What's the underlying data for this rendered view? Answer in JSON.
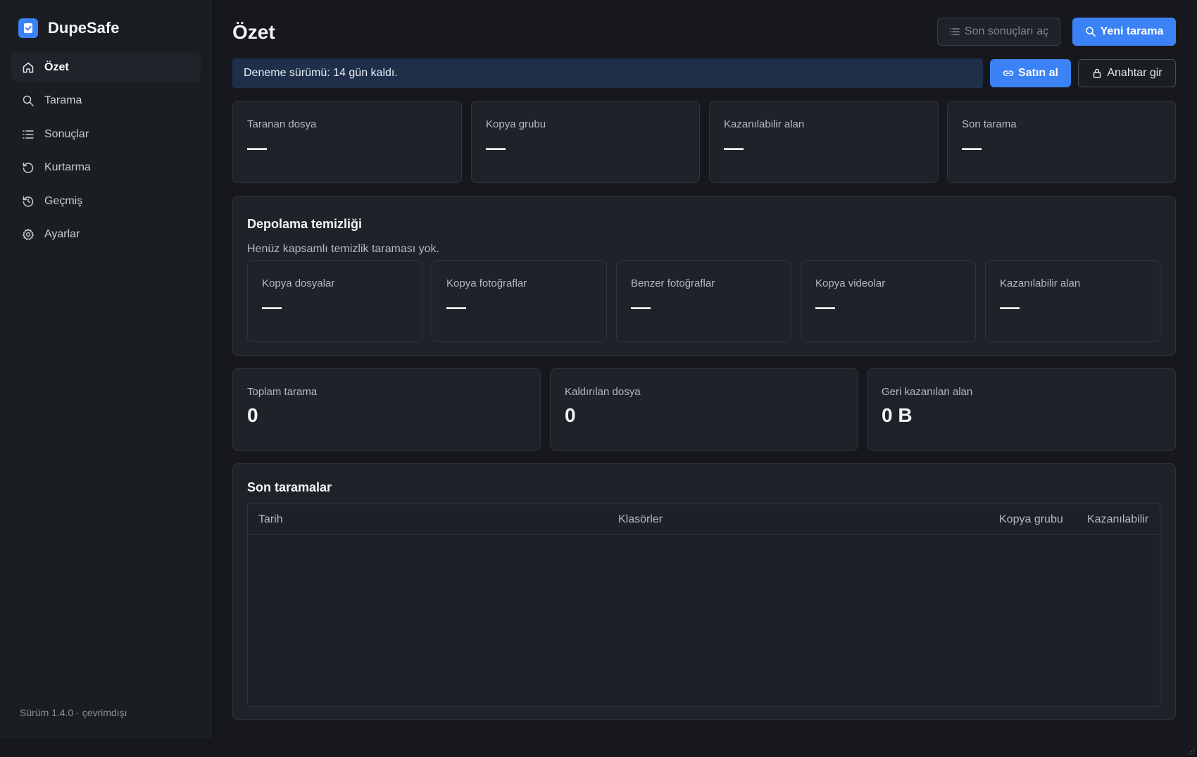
{
  "app": {
    "name": "DupeSafe",
    "version_text": "Sürüm 1.4.0 · çevrimdışı"
  },
  "sidebar": {
    "items": [
      {
        "label": "Özet",
        "icon": "home-icon",
        "active": true
      },
      {
        "label": "Tarama",
        "icon": "search-icon"
      },
      {
        "label": "Sonuçlar",
        "icon": "list-icon"
      },
      {
        "label": "Kurtarma",
        "icon": "restore-icon"
      },
      {
        "label": "Geçmiş",
        "icon": "history-icon"
      },
      {
        "label": "Ayarlar",
        "icon": "gear-icon"
      }
    ]
  },
  "header": {
    "title": "Özet",
    "open_results_label": "Son sonuçları aç",
    "new_scan_label": "Yeni tarama"
  },
  "trial": {
    "message": "Deneme sürümü: 14 gün kaldı.",
    "buy_label": "Satın al",
    "enter_key_label": "Anahtar gir"
  },
  "stats": [
    {
      "label": "Taranan dosya",
      "value": "—"
    },
    {
      "label": "Kopya grubu",
      "value": "—"
    },
    {
      "label": "Kazanılabilir alan",
      "value": "—"
    },
    {
      "label": "Son tarama",
      "value": "—"
    }
  ],
  "storage": {
    "title": "Depolama temizliği",
    "subtitle": "Henüz kapsamlı temizlik taraması yok.",
    "cards": [
      {
        "label": "Kopya dosyalar",
        "value": "—"
      },
      {
        "label": "Kopya fotoğraflar",
        "value": "—"
      },
      {
        "label": "Benzer fotoğraflar",
        "value": "—"
      },
      {
        "label": "Kopya videolar",
        "value": "—"
      },
      {
        "label": "Kazanılabilir alan",
        "value": "—"
      }
    ]
  },
  "totals": [
    {
      "label": "Toplam tarama",
      "value": "0"
    },
    {
      "label": "Kaldırılan dosya",
      "value": "0"
    },
    {
      "label": "Geri kazanılan alan",
      "value": "0 B"
    }
  ],
  "recent": {
    "title": "Son taramalar",
    "columns": [
      "Tarih",
      "Klasörler",
      "Kopya grubu",
      "Kazanılabilir"
    ],
    "rows": []
  },
  "colors": {
    "accent": "#3b82f6",
    "background": "#16181d",
    "sidebar": "#1a1d22",
    "card": "#1f2228",
    "banner": "#1f2f4a"
  }
}
